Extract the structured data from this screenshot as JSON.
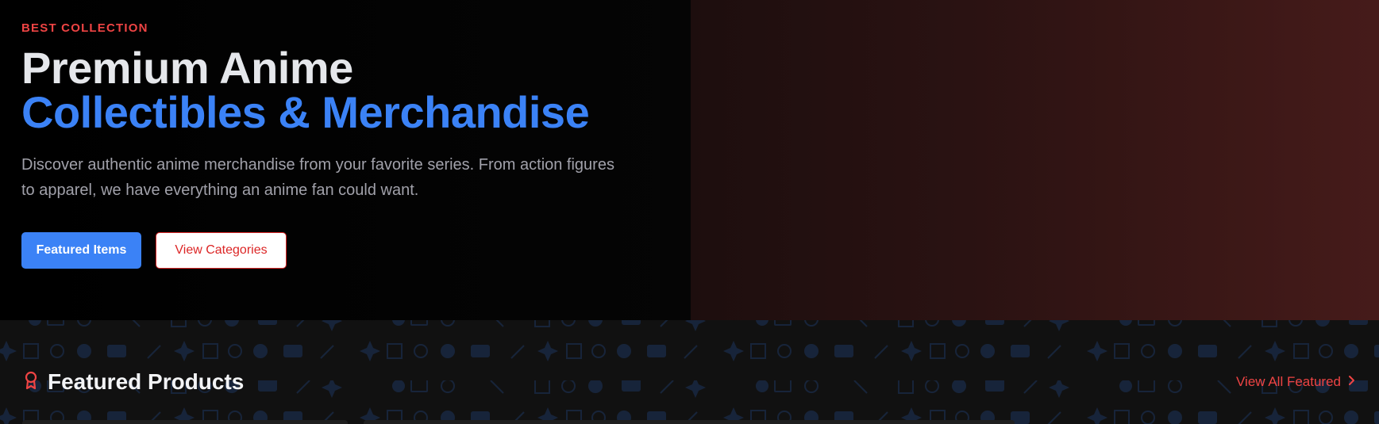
{
  "hero": {
    "eyebrow": "BEST COLLECTION",
    "title_line1": "Premium Anime",
    "title_line2": "Collectibles & Merchandise",
    "description": "Discover authentic anime merchandise from your favorite series. From action figures to apparel, we have everything an anime fan could want.",
    "primary_button": "Featured Items",
    "secondary_button": "View Categories"
  },
  "featured": {
    "title": "Featured Products",
    "title_icon": "award-icon",
    "view_all": "View All Featured",
    "view_all_icon": "chevron-right-icon"
  },
  "colors": {
    "accent_blue": "#3b82f6",
    "accent_red": "#ef4444",
    "background": "#000000"
  }
}
